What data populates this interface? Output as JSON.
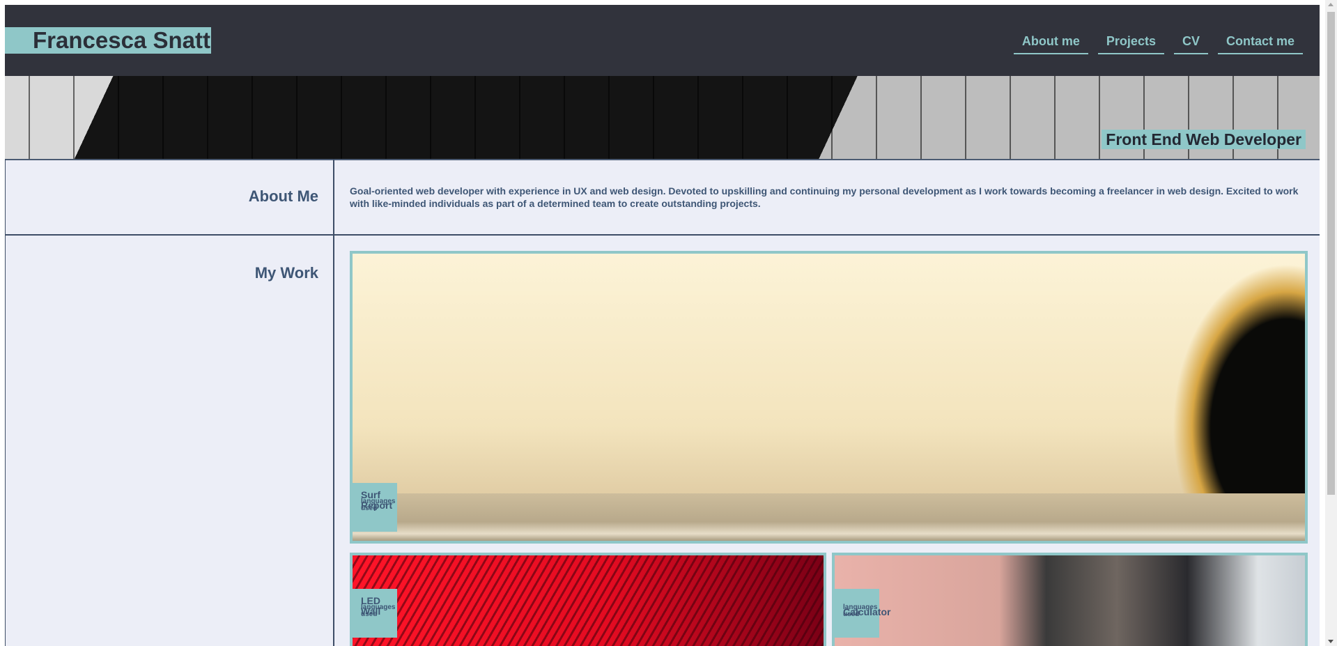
{
  "site": {
    "brand": "Francesca Snatt",
    "nav": [
      "About me",
      "Projects",
      "CV",
      "Contact me"
    ],
    "hero_tagline": "Front End Web Developer"
  },
  "about": {
    "heading": "About Me",
    "text": "Goal-oriented web developer with experience in UX and web design. Devoted to upskilling and continuing my personal development as I work towards becoming a freelancer in web design. Excited to work with like-minded individuals as part of a determined team to create outstanding projects."
  },
  "work": {
    "heading": "My Work",
    "projects": [
      {
        "name": "Surf Report",
        "languages": "languages used"
      },
      {
        "name": "LED Wall",
        "languages": "languages used"
      },
      {
        "name": "Calculator",
        "languages": "languages used"
      }
    ]
  },
  "colors": {
    "header_bg": "#31333c",
    "accent": "#8fc7c8",
    "page_bg": "#eceef7",
    "text_blue": "#3e5675"
  }
}
